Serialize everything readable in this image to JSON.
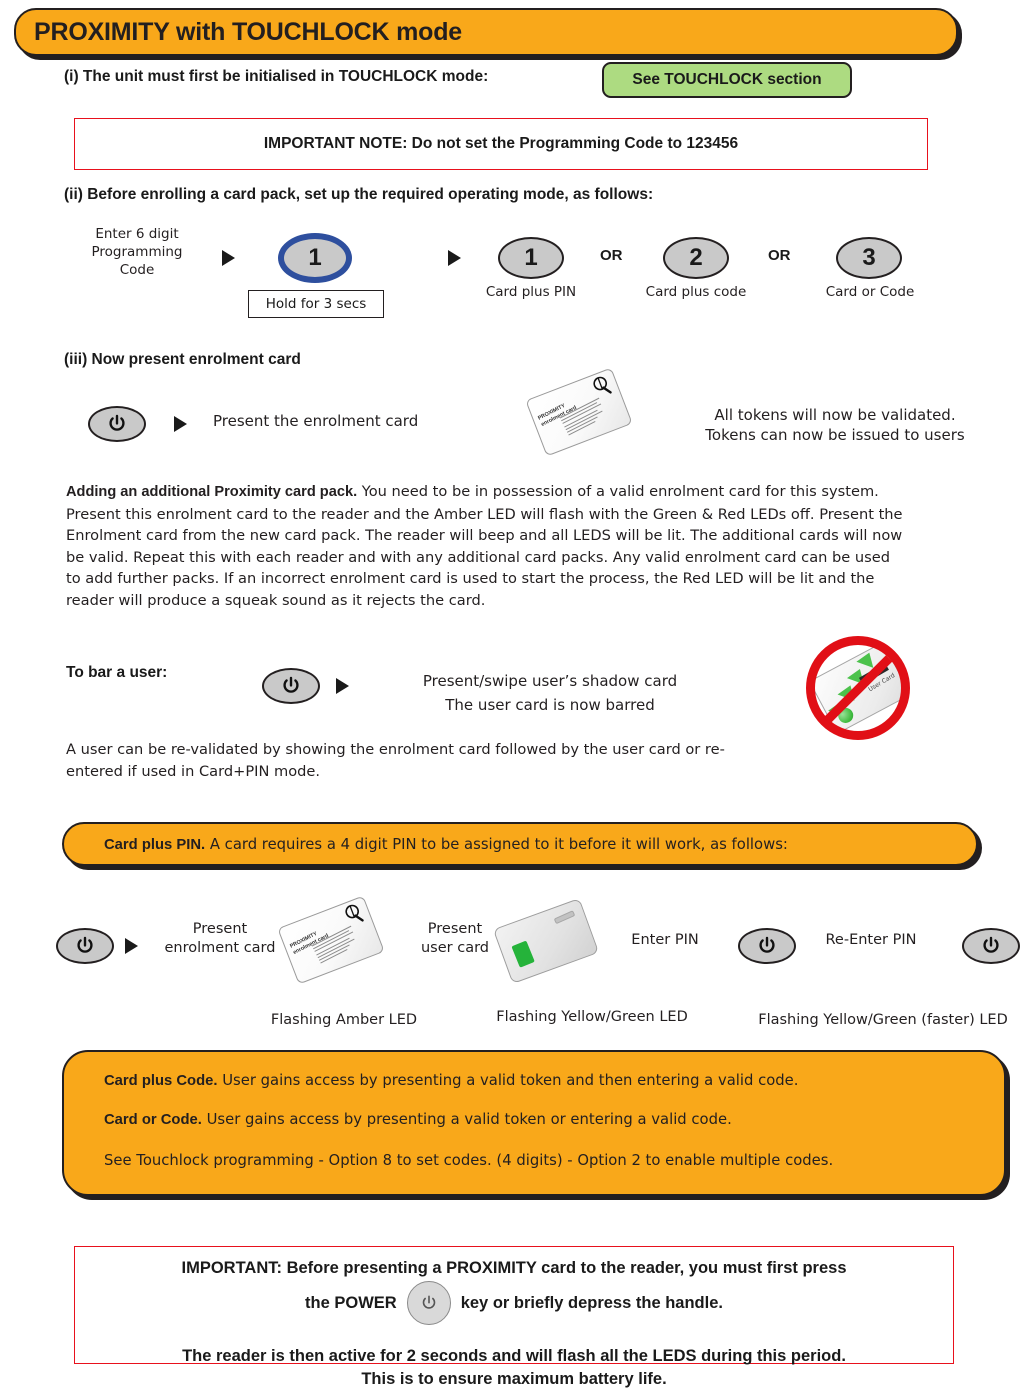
{
  "header": {
    "title": "PROXIMITY with TOUCHLOCK mode",
    "bar_color": "#f9a81a"
  },
  "step_i": {
    "text": "(i) The unit must first be initialised in TOUCHLOCK mode:",
    "badge_label": "See TOUCHLOCK section",
    "badge_color": "#addb81"
  },
  "important_note": {
    "text": "IMPORTANT NOTE: Do not set the Programming Code to 123456",
    "border_color": "#e8111d"
  },
  "step_ii": {
    "text": "(ii) Before enrolling a card pack, set up the required operating mode, as follows:",
    "enter_code_label": "Enter 6 digit\nProgramming\nCode",
    "mode_button": "1",
    "hold_label": "Hold for 3 secs",
    "highlight_color": "#2e4f9e",
    "options": [
      {
        "number": "1",
        "label": "Card plus PIN"
      },
      {
        "number": "2",
        "label": "Card plus code"
      },
      {
        "number": "3",
        "label": "Card or Code"
      }
    ],
    "or_label": "OR"
  },
  "step_iii": {
    "heading": "(iii) Now present enrolment card",
    "action_label": "Present the enrolment card",
    "result_line1": "All tokens will now be validated.",
    "result_line2": "Tokens can now be issued to users",
    "card_title_line1": "PROXIMITY",
    "card_title_line2": "enrolment card"
  },
  "adding_pack": {
    "heading": "Adding an additional Proximity card pack.",
    "body": "You need to be in possession of a valid enrolment card for this system.  Present this enrolment card to the reader and the Amber LED will flash with the Green & Red LEDs off. Present the Enrolment card from the new card pack. The reader will beep and all LEDS will be lit. The additional cards will now be valid. Repeat this with each reader and with any additional card packs. Any valid enrolment card can be used to add further packs. If an incorrect enrolment card is used to start the process, the Red LED will be lit and the reader will produce a squeak sound as it rejects the card."
  },
  "bar_user": {
    "heading": "To bar a user:",
    "action_line1": "Present/swipe user’s shadow card",
    "action_line2": "The user card is now barred",
    "card_label": "User Card",
    "revalidate_text": "A user can be re-validated by showing the enrolment card followed by the user card or re-entered if used in Card+PIN mode."
  },
  "card_plus_pin_banner": {
    "bold": "Card plus PIN.",
    "rest": "A card requires a 4 digit PIN to be assigned to it before it will work, as follows:"
  },
  "pin_flow": {
    "steps": [
      {
        "label_line1": "Present",
        "label_line2": "enrolment card"
      },
      {
        "label_line1": "Present",
        "label_line2": "user card"
      },
      {
        "label_line1": "Enter PIN",
        "label_line2": ""
      },
      {
        "label_line1": "Re-Enter PIN",
        "label_line2": ""
      }
    ],
    "led_amber": "Flashing Amber LED",
    "led_yellow_green": "Flashing Yellow/Green LED",
    "led_yellow_green_faster": "Flashing Yellow/Green (faster) LED"
  },
  "code_panel": {
    "line1_bold": "Card plus Code.",
    "line1_rest": "User gains access by presenting a valid token and then entering a valid code.",
    "line2_bold": "Card or Code.",
    "line2_rest": "User gains access by presenting a valid token or entering a valid code.",
    "line3": "See Touchlock programming - Option 8 to set codes. (4 digits) - Option 2 to enable multiple codes."
  },
  "final_note": {
    "line1": "IMPORTANT:  Before presenting a PROXIMITY card to the reader, you must first press",
    "line2a": "the POWER",
    "line2b": "key or briefly depress the handle.",
    "line3": "The reader is then active for 2 seconds and will flash all the LEDS during this period.",
    "line4": "This is to ensure maximum battery life."
  }
}
